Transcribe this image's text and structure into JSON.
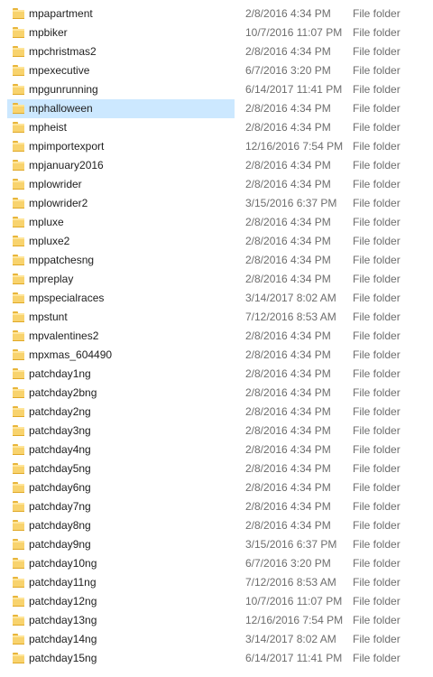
{
  "list": {
    "selected_index": 5,
    "rows": [
      {
        "name": "mpapartment",
        "date": "2/8/2016 4:34 PM",
        "type": "File folder"
      },
      {
        "name": "mpbiker",
        "date": "10/7/2016 11:07 PM",
        "type": "File folder"
      },
      {
        "name": "mpchristmas2",
        "date": "2/8/2016 4:34 PM",
        "type": "File folder"
      },
      {
        "name": "mpexecutive",
        "date": "6/7/2016 3:20 PM",
        "type": "File folder"
      },
      {
        "name": "mpgunrunning",
        "date": "6/14/2017 11:41 PM",
        "type": "File folder"
      },
      {
        "name": "mphalloween",
        "date": "2/8/2016 4:34 PM",
        "type": "File folder"
      },
      {
        "name": "mpheist",
        "date": "2/8/2016 4:34 PM",
        "type": "File folder"
      },
      {
        "name": "mpimportexport",
        "date": "12/16/2016 7:54 PM",
        "type": "File folder"
      },
      {
        "name": "mpjanuary2016",
        "date": "2/8/2016 4:34 PM",
        "type": "File folder"
      },
      {
        "name": "mplowrider",
        "date": "2/8/2016 4:34 PM",
        "type": "File folder"
      },
      {
        "name": "mplowrider2",
        "date": "3/15/2016 6:37 PM",
        "type": "File folder"
      },
      {
        "name": "mpluxe",
        "date": "2/8/2016 4:34 PM",
        "type": "File folder"
      },
      {
        "name": "mpluxe2",
        "date": "2/8/2016 4:34 PM",
        "type": "File folder"
      },
      {
        "name": "mppatchesng",
        "date": "2/8/2016 4:34 PM",
        "type": "File folder"
      },
      {
        "name": "mpreplay",
        "date": "2/8/2016 4:34 PM",
        "type": "File folder"
      },
      {
        "name": "mpspecialraces",
        "date": "3/14/2017 8:02 AM",
        "type": "File folder"
      },
      {
        "name": "mpstunt",
        "date": "7/12/2016 8:53 AM",
        "type": "File folder"
      },
      {
        "name": "mpvalentines2",
        "date": "2/8/2016 4:34 PM",
        "type": "File folder"
      },
      {
        "name": "mpxmas_604490",
        "date": "2/8/2016 4:34 PM",
        "type": "File folder"
      },
      {
        "name": "patchday1ng",
        "date": "2/8/2016 4:34 PM",
        "type": "File folder"
      },
      {
        "name": "patchday2bng",
        "date": "2/8/2016 4:34 PM",
        "type": "File folder"
      },
      {
        "name": "patchday2ng",
        "date": "2/8/2016 4:34 PM",
        "type": "File folder"
      },
      {
        "name": "patchday3ng",
        "date": "2/8/2016 4:34 PM",
        "type": "File folder"
      },
      {
        "name": "patchday4ng",
        "date": "2/8/2016 4:34 PM",
        "type": "File folder"
      },
      {
        "name": "patchday5ng",
        "date": "2/8/2016 4:34 PM",
        "type": "File folder"
      },
      {
        "name": "patchday6ng",
        "date": "2/8/2016 4:34 PM",
        "type": "File folder"
      },
      {
        "name": "patchday7ng",
        "date": "2/8/2016 4:34 PM",
        "type": "File folder"
      },
      {
        "name": "patchday8ng",
        "date": "2/8/2016 4:34 PM",
        "type": "File folder"
      },
      {
        "name": "patchday9ng",
        "date": "3/15/2016 6:37 PM",
        "type": "File folder"
      },
      {
        "name": "patchday10ng",
        "date": "6/7/2016 3:20 PM",
        "type": "File folder"
      },
      {
        "name": "patchday11ng",
        "date": "7/12/2016 8:53 AM",
        "type": "File folder"
      },
      {
        "name": "patchday12ng",
        "date": "10/7/2016 11:07 PM",
        "type": "File folder"
      },
      {
        "name": "patchday13ng",
        "date": "12/16/2016 7:54 PM",
        "type": "File folder"
      },
      {
        "name": "patchday14ng",
        "date": "3/14/2017 8:02 AM",
        "type": "File folder"
      },
      {
        "name": "patchday15ng",
        "date": "6/14/2017 11:41 PM",
        "type": "File folder"
      }
    ]
  },
  "colors": {
    "selection": "#cce8ff",
    "folder": "#f8d36e",
    "secondary_text": "#6d6d6d"
  },
  "icons": {
    "row_icon": "folder-icon"
  }
}
